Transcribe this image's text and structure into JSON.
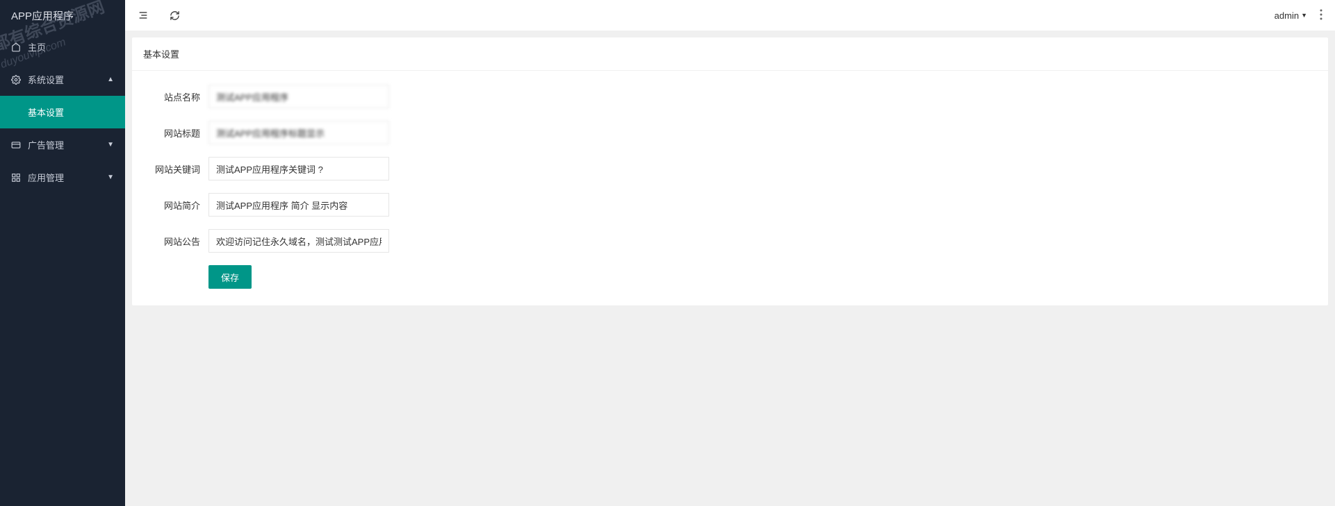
{
  "sidebar": {
    "logo": "APP应用程序",
    "items": [
      {
        "icon": "home",
        "label": "主页"
      },
      {
        "icon": "gear",
        "label": "系统设置",
        "expanded": true
      },
      {
        "icon": "ad",
        "label": "广告管理",
        "expanded": false
      },
      {
        "icon": "grid",
        "label": "应用管理",
        "expanded": false
      }
    ],
    "submenu": {
      "label": "基本设置"
    }
  },
  "watermark": {
    "line1": "都有综合资源网",
    "line2": "duyouvip.com"
  },
  "topbar": {
    "user": "admin"
  },
  "card": {
    "title": "基本设置"
  },
  "form": {
    "fields": [
      {
        "label": "站点名称",
        "value": "测试APP应用程序"
      },
      {
        "label": "网站标题",
        "value": "测试APP应用程序标题显示"
      },
      {
        "label": "网站关键词",
        "value": "测试APP应用程序关键词 ?"
      },
      {
        "label": "网站简介",
        "value": "测试APP应用程序 简介 显示内容"
      },
      {
        "label": "网站公告",
        "value": "欢迎访问记住永久域名，测试测试APP应用程序"
      }
    ],
    "submit": "保存"
  }
}
